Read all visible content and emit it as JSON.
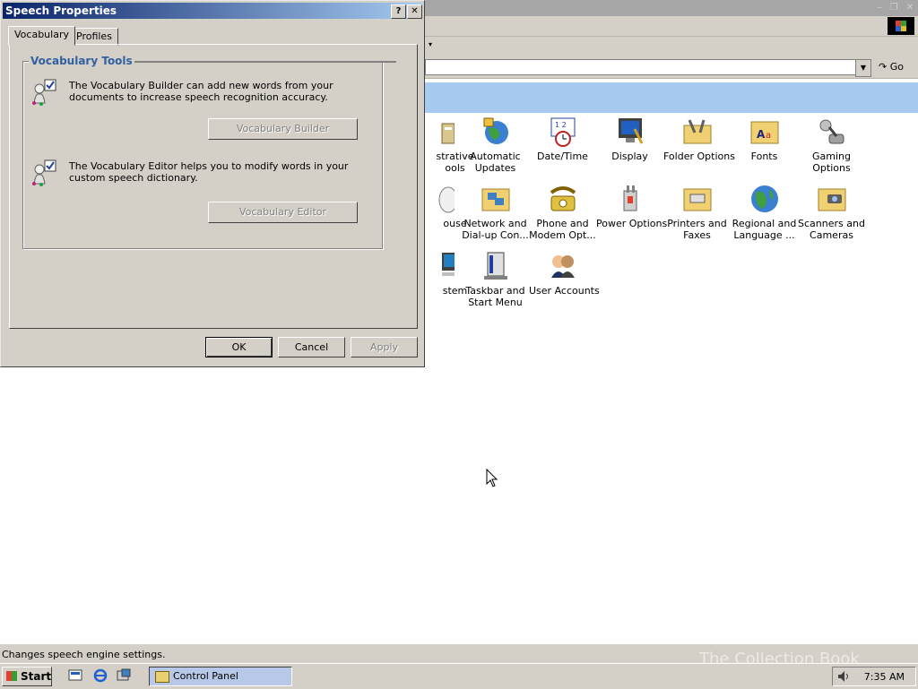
{
  "control_panel": {
    "toolbar_fragment": "▾",
    "go_label": "Go",
    "icons": [
      {
        "id": "admin",
        "label": "strative\nools"
      },
      {
        "id": "autoupdates",
        "label": "Automatic\nUpdates"
      },
      {
        "id": "datetime",
        "label": "Date/Time"
      },
      {
        "id": "display",
        "label": "Display"
      },
      {
        "id": "folderopts",
        "label": "Folder Options"
      },
      {
        "id": "fonts",
        "label": "Fonts"
      },
      {
        "id": "gaming",
        "label": "Gaming\nOptions"
      },
      {
        "id": "mouse",
        "label": "ouse"
      },
      {
        "id": "network",
        "label": "Network and\nDial-up Con..."
      },
      {
        "id": "phone",
        "label": "Phone and\nModem Opt..."
      },
      {
        "id": "power",
        "label": "Power Options"
      },
      {
        "id": "printers",
        "label": "Printers and\nFaxes"
      },
      {
        "id": "regional",
        "label": "Regional and\nLanguage ..."
      },
      {
        "id": "scanners",
        "label": "Scanners and\nCameras"
      },
      {
        "id": "system",
        "label": "stem"
      },
      {
        "id": "taskbar",
        "label": "Taskbar and\nStart Menu"
      },
      {
        "id": "users",
        "label": "User Accounts"
      }
    ],
    "status_text": "Changes speech engine settings."
  },
  "dialog": {
    "title": "Speech Properties",
    "help_glyph": "?",
    "close_glyph": "✕",
    "tabs": [
      {
        "label": "Vocabulary",
        "active": true
      },
      {
        "label": "Profiles",
        "active": false
      }
    ],
    "group_title": "Vocabulary Tools",
    "builder_desc": "The Vocabulary Builder can add new words from your documents to increase speech recognition accuracy.",
    "builder_button": "Vocabulary Builder",
    "editor_desc": "The Vocabulary Editor helps you to modify words in your custom speech dictionary.",
    "editor_button": "Vocabulary Editor",
    "ok_label": "OK",
    "cancel_label": "Cancel",
    "apply_label": "Apply"
  },
  "taskbar": {
    "start_label": "Start",
    "task_label": "Control Panel",
    "clock": "7:35 AM"
  },
  "watermark": "The Collection Book"
}
